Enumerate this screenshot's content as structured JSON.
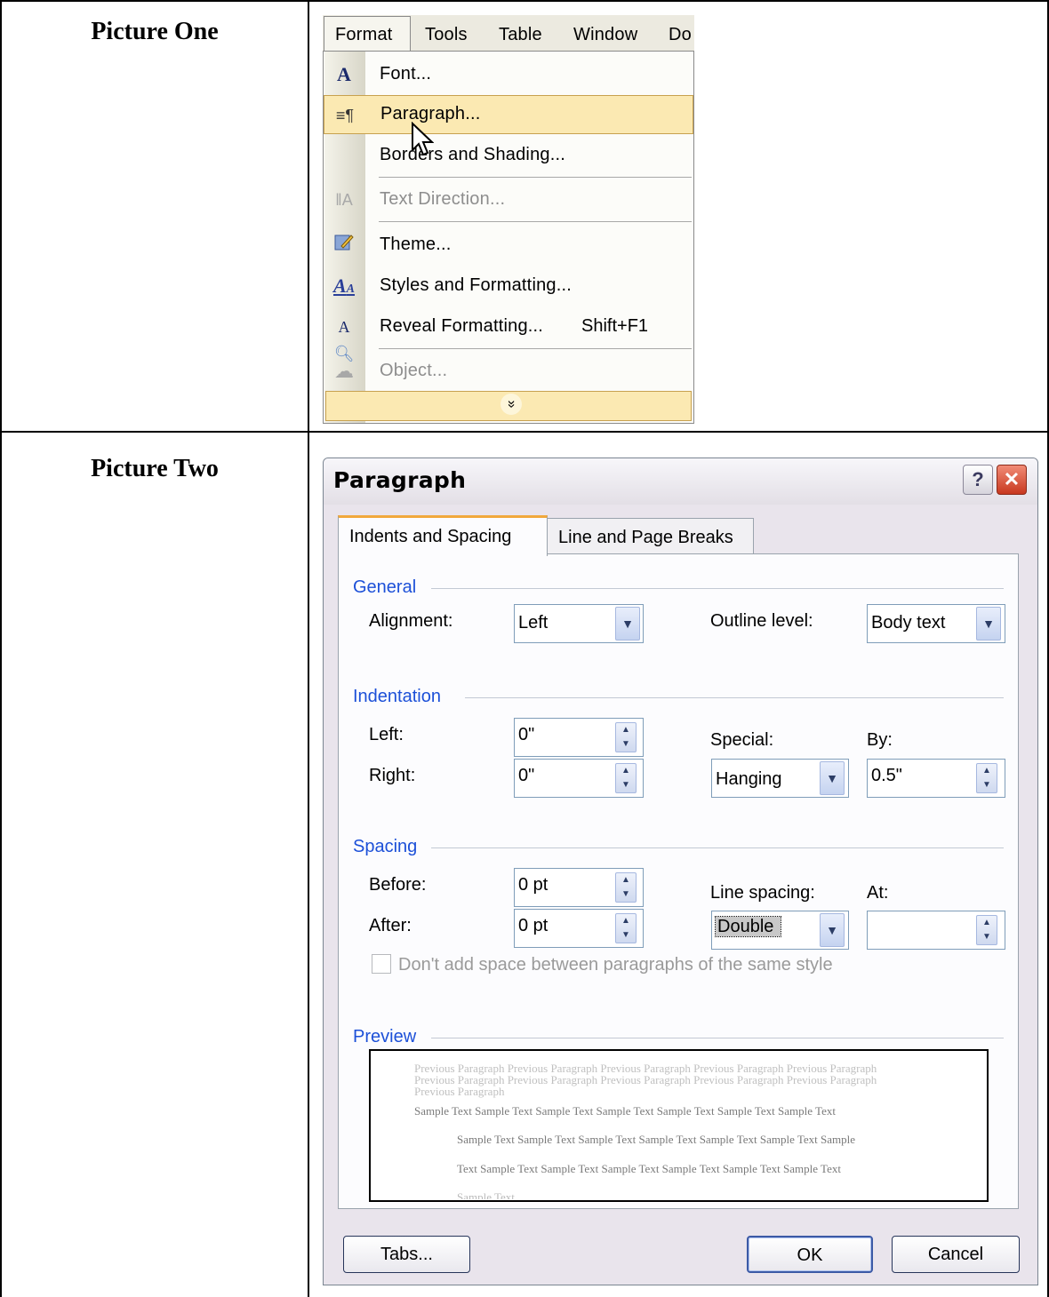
{
  "labels": {
    "picture_one": "Picture One",
    "picture_two": "Picture Two"
  },
  "menubar": {
    "items": [
      "Format",
      "Tools",
      "Table",
      "Window",
      "Do"
    ]
  },
  "format_menu": {
    "items": [
      {
        "label": "Font...",
        "icon": "font-A-icon",
        "disabled": false
      },
      {
        "label": "Paragraph...",
        "icon": "paragraph-icon",
        "disabled": false,
        "highlighted": true
      },
      {
        "label": "Borders and Shading...",
        "icon": "",
        "disabled": false
      },
      {
        "label": "Text Direction...",
        "icon": "text-direction-icon",
        "disabled": true
      },
      {
        "label": "Theme...",
        "icon": "theme-icon",
        "disabled": false
      },
      {
        "label": "Styles and Formatting...",
        "icon": "styles-icon",
        "disabled": false
      },
      {
        "label": "Reveal Formatting...",
        "shortcut": "Shift+F1",
        "icon": "reveal-formatting-icon",
        "disabled": false
      },
      {
        "label": "Object...",
        "icon": "object-icon",
        "disabled": true
      }
    ],
    "expand_glyph": "»"
  },
  "dialog": {
    "title": "Paragraph",
    "help": "?",
    "close": "✕",
    "tabs": [
      "Indents and Spacing",
      "Line and Page Breaks"
    ],
    "general": {
      "section": "General",
      "alignment_label": "Alignment:",
      "alignment_value": "Left",
      "outline_label": "Outline level:",
      "outline_value": "Body text"
    },
    "indentation": {
      "section": "Indentation",
      "left_label": "Left:",
      "left_value": "0\"",
      "right_label": "Right:",
      "right_value": "0\"",
      "special_label": "Special:",
      "special_value": "Hanging",
      "by_label": "By:",
      "by_value": "0.5\""
    },
    "spacing": {
      "section": "Spacing",
      "before_label": "Before:",
      "before_value": "0 pt",
      "after_label": "After:",
      "after_value": "0 pt",
      "line_spacing_label": "Line spacing:",
      "line_spacing_value": "Double",
      "at_label": "At:",
      "at_value": "",
      "checkbox_label": "Don't add space between paragraphs of the same style"
    },
    "preview": {
      "section": "Preview",
      "previous": "Previous Paragraph Previous Paragraph Previous Paragraph Previous Paragraph Previous Paragraph Previous Paragraph Previous Paragraph Previous Paragraph Previous Paragraph Previous Paragraph Previous Paragraph",
      "line1": "Sample Text Sample Text Sample Text Sample Text Sample Text Sample Text Sample Text",
      "line2": "Sample Text Sample Text Sample Text Sample Text Sample Text Sample Text Sample",
      "line3": "Text Sample Text Sample Text Sample Text Sample Text Sample Text Sample Text",
      "line4": "Sample Text"
    },
    "buttons": {
      "tabs": "Tabs...",
      "ok": "OK",
      "cancel": "Cancel"
    }
  }
}
